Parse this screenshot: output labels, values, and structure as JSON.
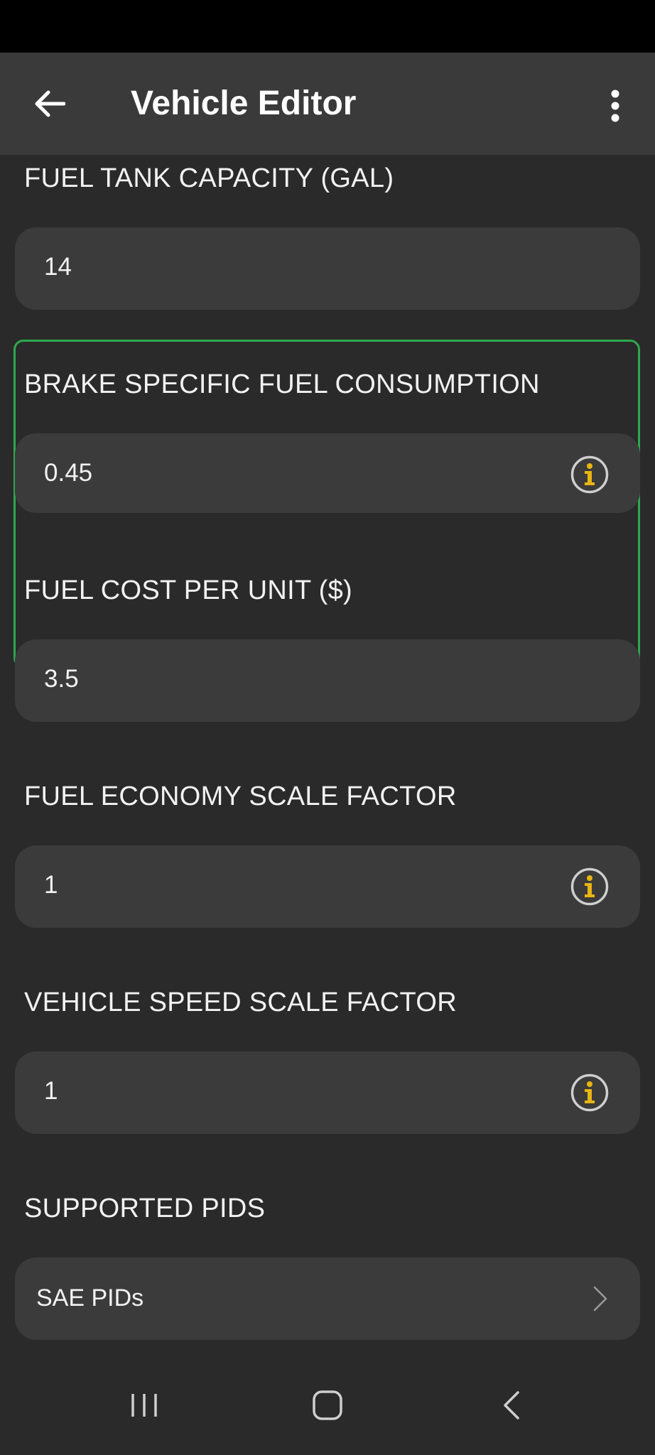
{
  "app_bar": {
    "title": "Vehicle Editor",
    "back_icon": "arrow-left-icon",
    "menu_icon": "more-vertical-icon"
  },
  "fields": [
    {
      "label": "FUEL TANK CAPACITY (GAL)",
      "value": "14",
      "has_info": false
    },
    {
      "label": "BRAKE SPECIFIC FUEL CONSUMPTION",
      "value": "0.45",
      "has_info": true,
      "focused": true
    },
    {
      "label": "FUEL COST PER UNIT ($)",
      "value": "3.5",
      "has_info": false
    },
    {
      "label": "FUEL ECONOMY SCALE FACTOR",
      "value": "1",
      "has_info": true
    },
    {
      "label": "VEHICLE SPEED SCALE FACTOR",
      "value": "1",
      "has_info": true
    }
  ],
  "supported_pids": {
    "label": "SUPPORTED PIDS",
    "item": "SAE PIDs",
    "chevron_icon": "chevron-right-icon"
  },
  "colors": {
    "focus_border": "#2ea84f",
    "info_icon": "#e9b512",
    "background": "#2a2a2a",
    "field_background": "#3b3b3b",
    "app_bar": "#3a3a3a"
  },
  "system_nav": {
    "recents_icon": "recents-icon",
    "home_icon": "home-icon",
    "back_icon": "back-chevron-icon"
  }
}
